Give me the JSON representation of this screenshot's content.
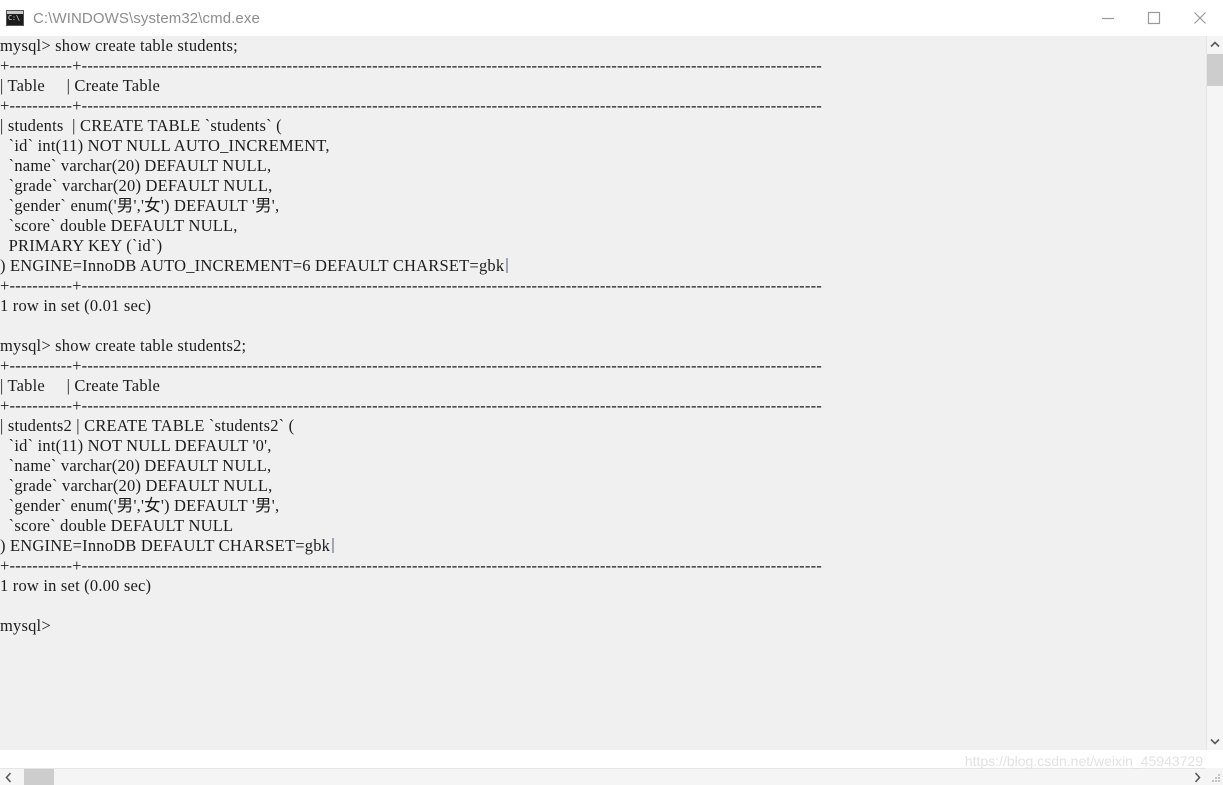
{
  "window": {
    "title": "C:\\WINDOWS\\system32\\cmd.exe",
    "icon_label": "C:\\",
    "icon_name": "cmd-console-icon",
    "controls": {
      "minimize": "minimize-button",
      "maximize": "maximize-button",
      "close": "close-button"
    }
  },
  "terminal": {
    "background_color": "#f0f0f0",
    "text_color": "#1c1c1c",
    "lines": [
      "mysql> show create table students;",
      "+-----------+----------------------------------------------------------------------------------------------------------------------------------",
      "| Table     | Create Table",
      "+-----------+----------------------------------------------------------------------------------------------------------------------------------",
      "| students  | CREATE TABLE `students` (",
      "  `id` int(11) NOT NULL AUTO_INCREMENT,",
      "  `name` varchar(20) DEFAULT NULL,",
      "  `grade` varchar(20) DEFAULT NULL,",
      "  `gender` enum('男','女') DEFAULT '男',",
      "  `score` double DEFAULT NULL,",
      "  PRIMARY KEY (`id`)",
      ") ENGINE=InnoDB AUTO_INCREMENT=6 DEFAULT CHARSET=gbk  |",
      "+-----------+----------------------------------------------------------------------------------------------------------------------------------",
      "1 row in set (0.01 sec)",
      "",
      "mysql> show create table students2;",
      "+-----------+----------------------------------------------------------------------------------------------------------------------------------",
      "| Table     | Create Table",
      "+-----------+----------------------------------------------------------------------------------------------------------------------------------",
      "| students2 | CREATE TABLE `students2` (",
      "  `id` int(11) NOT NULL DEFAULT '0',",
      "  `name` varchar(20) DEFAULT NULL,",
      "  `grade` varchar(20) DEFAULT NULL,",
      "  `gender` enum('男','女') DEFAULT '男',",
      "  `score` double DEFAULT NULL",
      ") ENGINE=InnoDB DEFAULT CHARSET=gbk  |",
      "+-----------+----------------------------------------------------------------------------------------------------------------------------------",
      "1 row in set (0.00 sec)",
      "",
      "mysql>"
    ]
  },
  "scrollbars": {
    "vertical": {
      "up_arrow": "scroll-up-arrow",
      "down_arrow": "scroll-down-arrow",
      "thumb": "vertical-scroll-thumb"
    },
    "horizontal": {
      "left_arrow": "scroll-left-arrow",
      "right_arrow": "scroll-right-arrow",
      "thumb": "horizontal-scroll-thumb"
    }
  },
  "watermark": {
    "text": "https://blog.csdn.net/weixin_45943729"
  }
}
